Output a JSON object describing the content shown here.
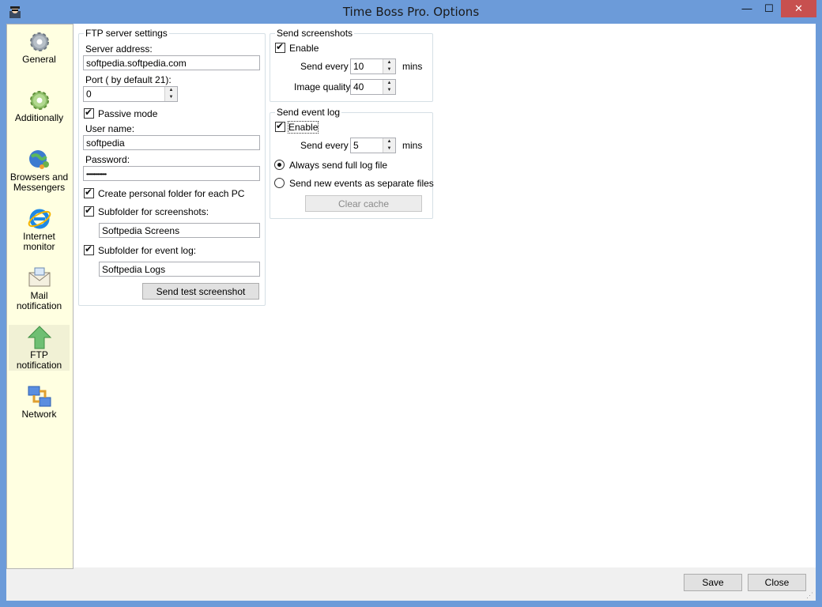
{
  "window": {
    "title": "Time Boss Pro. Options",
    "min": "—",
    "max": "☐",
    "close": "✕"
  },
  "sidebar": {
    "items": [
      {
        "label": "General",
        "icon": "gear-icon"
      },
      {
        "label": "Additionally",
        "icon": "gear-icon"
      },
      {
        "label": "Browsers and Messengers",
        "icon": "globe-users-icon"
      },
      {
        "label": "Internet monitor",
        "icon": "internet-explorer-icon"
      },
      {
        "label": "Mail notification",
        "icon": "mail-icon"
      },
      {
        "label": "FTP notification",
        "icon": "upload-arrow-icon",
        "active": true
      },
      {
        "label": "Network",
        "icon": "network-icon"
      }
    ]
  },
  "ftp": {
    "group_title": "FTP server settings",
    "server_label": "Server address:",
    "server_value": "softpedia.softpedia.com",
    "port_label": "Port  ( by default 21):",
    "port_value": "0",
    "passive_label": "Passive mode",
    "user_label": "User name:",
    "user_value": "softpedia",
    "password_label": "Password:",
    "password_value": "••••••••••••••",
    "personal_folder_label": "Create personal folder for each PC",
    "sub_screens_label": "Subfolder for screenshots:",
    "sub_screens_value": "Softpedia Screens",
    "sub_log_label": "Subfolder for event log:",
    "sub_log_value": "Softpedia Logs",
    "send_test_label": "Send test screenshot"
  },
  "screenshots": {
    "group_title": "Send screenshots",
    "enable_label": "Enable",
    "send_every_label": "Send every",
    "send_every_value": "10",
    "mins_label": "mins",
    "quality_label": "Image quality",
    "quality_value": "40"
  },
  "eventlog": {
    "group_title": "Send event log",
    "enable_label": "Enable",
    "send_every_label": "Send every",
    "send_every_value": "5",
    "mins_label": "mins",
    "full_label": "Always send full log file",
    "separate_label": "Send new events as separate files",
    "clear_label": "Clear cache"
  },
  "footer": {
    "save_label": "Save",
    "close_label": "Close"
  },
  "colors": {
    "titlebar": "#6c9bd9",
    "sidebar_bg": "#ffffe1",
    "close_btn": "#c7504f"
  }
}
